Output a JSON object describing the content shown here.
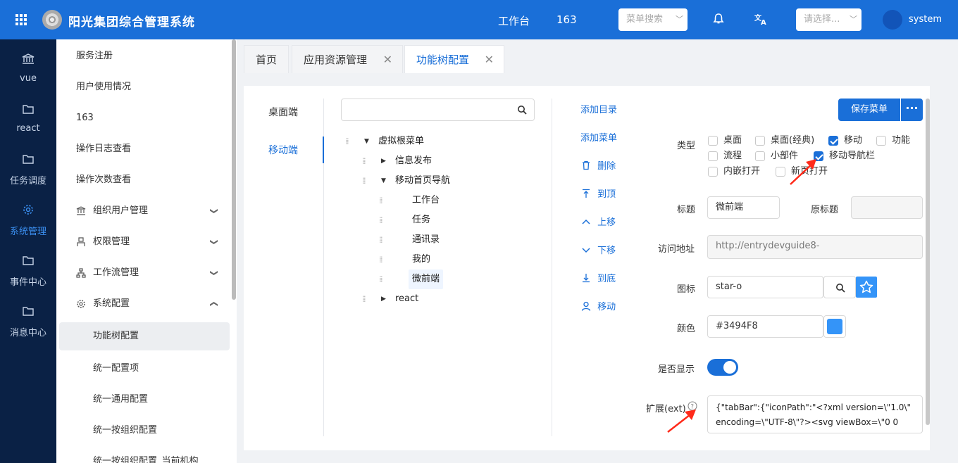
{
  "header": {
    "app_title": "阳光集团综合管理系统",
    "workbench": "工作台",
    "count": "163",
    "menu_search_placeholder": "菜单搜索",
    "select_placeholder": "请选择...",
    "username": "system"
  },
  "rail": [
    {
      "label": "vue",
      "icon": "bank-icon"
    },
    {
      "label": "react",
      "icon": "folder-icon"
    },
    {
      "label": "任务调度",
      "icon": "folder-icon"
    },
    {
      "label": "系统管理",
      "icon": "gear-icon"
    },
    {
      "label": "事件中心",
      "icon": "folder-icon"
    },
    {
      "label": "消息中心",
      "icon": "folder-icon"
    }
  ],
  "menu": [
    {
      "label": "服务注册"
    },
    {
      "label": "用户使用情况"
    },
    {
      "label": "163"
    },
    {
      "label": "操作日志查看"
    },
    {
      "label": "操作次数查看"
    },
    {
      "label": "组织用户管理",
      "icon": "bank-icon"
    },
    {
      "label": "权限管理",
      "icon": "user-icon"
    },
    {
      "label": "工作流管理",
      "icon": "flow-icon"
    },
    {
      "label": "系统配置",
      "icon": "gear-icon"
    },
    {
      "label": "功能树配置"
    },
    {
      "label": "统一配置项"
    },
    {
      "label": "统一通用配置"
    },
    {
      "label": "统一按组织配置"
    },
    {
      "label": "统一按组织配置_当前机构"
    }
  ],
  "tabs": [
    {
      "label": "首页"
    },
    {
      "label": "应用资源管理"
    },
    {
      "label": "功能树配置"
    }
  ],
  "side_tabs": [
    {
      "label": "桌面端"
    },
    {
      "label": "移动端"
    }
  ],
  "tree": [
    {
      "label": "虚拟根菜单"
    },
    {
      "label": "信息发布"
    },
    {
      "label": "移动首页导航"
    },
    {
      "label": "工作台"
    },
    {
      "label": "任务"
    },
    {
      "label": "通讯录"
    },
    {
      "label": "我的"
    },
    {
      "label": "微前端"
    },
    {
      "label": "react"
    }
  ],
  "actions": [
    {
      "label": "添加目录"
    },
    {
      "label": "添加菜单"
    },
    {
      "label": "删除",
      "icon": "trash-icon"
    },
    {
      "label": "到顶",
      "icon": "to-top-icon"
    },
    {
      "label": "上移",
      "icon": "chevron-up-icon"
    },
    {
      "label": "下移",
      "icon": "chevron-down-icon"
    },
    {
      "label": "到底",
      "icon": "to-bottom-icon"
    },
    {
      "label": "移动",
      "icon": "user-icon"
    }
  ],
  "form": {
    "save_label": "保存菜单",
    "more_label": "···",
    "type_label": "类型",
    "types": [
      {
        "label": "桌面",
        "checked": false
      },
      {
        "label": "桌面(经典)",
        "checked": false
      },
      {
        "label": "移动",
        "checked": true
      },
      {
        "label": "功能",
        "checked": false
      },
      {
        "label": "流程",
        "checked": false
      },
      {
        "label": "小部件",
        "checked": false
      },
      {
        "label": "移动导航栏",
        "checked": true
      },
      {
        "label": "内嵌打开",
        "checked": false
      },
      {
        "label": "新页打开",
        "checked": false
      }
    ],
    "title_label": "标题",
    "title_value": "微前端",
    "orig_title_label": "原标题",
    "url_label": "访问地址",
    "url_value": "http://entrydevguide8-",
    "icon_label": "图标",
    "icon_value": "star-o",
    "color_label": "颜色",
    "color_value": "#3494F8",
    "show_label": "是否显示",
    "show_value": true,
    "ext_label": "扩展(ext)",
    "ext_value": "{\"tabBar\":{\"iconPath\":\"<?xml version=\\\"1.0\\\" encoding=\\\"UTF-8\\\"?><svg viewBox=\\\"0 0"
  },
  "colors": {
    "primary": "#1a6fd8",
    "header": "#1a6fd8",
    "rail": "#0a2145",
    "swatch": "#3494F8",
    "annotation": "#ff2a1a"
  }
}
